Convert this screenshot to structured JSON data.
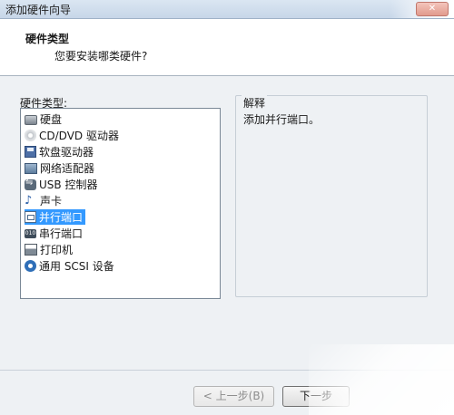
{
  "window": {
    "title": "添加硬件向导"
  },
  "header": {
    "title": "硬件类型",
    "subtitle": "您要安装哪类硬件?"
  },
  "list": {
    "label": "硬件类型:",
    "items": [
      {
        "label": "硬盘",
        "icon": "hard-disk-icon"
      },
      {
        "label": "CD/DVD 驱动器",
        "icon": "cd-dvd-icon"
      },
      {
        "label": "软盘驱动器",
        "icon": "floppy-icon"
      },
      {
        "label": "网络适配器",
        "icon": "network-adapter-icon"
      },
      {
        "label": "USB 控制器",
        "icon": "usb-icon"
      },
      {
        "label": "声卡",
        "icon": "sound-icon"
      },
      {
        "label": "并行端口",
        "icon": "parallel-port-icon",
        "selected": true
      },
      {
        "label": "串行端口",
        "icon": "serial-port-icon"
      },
      {
        "label": "打印机",
        "icon": "printer-icon"
      },
      {
        "label": "通用 SCSI 设备",
        "icon": "scsi-icon"
      }
    ]
  },
  "explanation": {
    "title": "解释",
    "text": "添加并行端口。"
  },
  "footer": {
    "back_label": "< 上一步(B)",
    "next_label": "下一步"
  },
  "colors": {
    "selection": "#3399ff",
    "header_bg": "#ffffff",
    "dialog_bg": "#eef1f4"
  }
}
